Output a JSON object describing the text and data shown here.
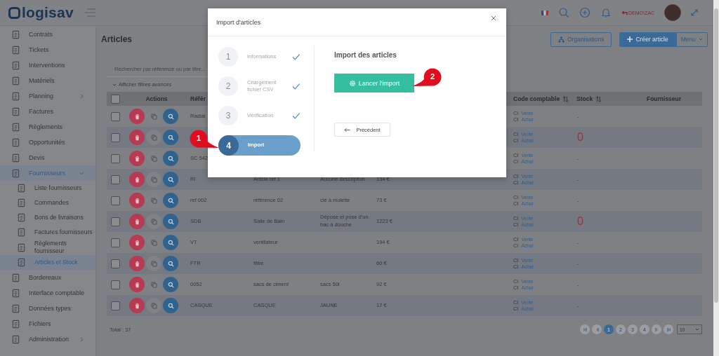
{
  "sidebar": {
    "logo": "logisav",
    "items": [
      {
        "label": "Contrats",
        "selected": false
      },
      {
        "label": "Tickets",
        "selected": false
      },
      {
        "label": "Interventions",
        "selected": false
      },
      {
        "label": "Matériels",
        "selected": false
      },
      {
        "label": "Planning",
        "selected": false,
        "expanded": false
      },
      {
        "label": "Factures",
        "selected": false
      },
      {
        "label": "Règlements",
        "selected": false
      },
      {
        "label": "Opportunités",
        "selected": false
      },
      {
        "label": "Devis",
        "selected": false
      },
      {
        "label": "Fournisseurs",
        "selected": true,
        "expanded": true,
        "children": [
          {
            "label": "Liste fournisseurs",
            "selected": false
          },
          {
            "label": "Commandes",
            "selected": false
          },
          {
            "label": "Bons de livraisons",
            "selected": false
          },
          {
            "label": "Factures fournisseurs",
            "selected": false
          },
          {
            "label": "Règlements fournisseur",
            "selected": false
          },
          {
            "label": "Articles et Stock",
            "selected": true
          }
        ]
      },
      {
        "label": "Bordereaux",
        "selected": false
      },
      {
        "label": "Interface comptable",
        "selected": false
      },
      {
        "label": "Données types",
        "selected": false
      },
      {
        "label": "Fichiers",
        "selected": false
      },
      {
        "label": "Administration",
        "selected": false,
        "expanded": false
      }
    ]
  },
  "topbar": {
    "user": "DEMO\\ZAC"
  },
  "page": {
    "title": "Articles",
    "buttons": [
      {
        "label": "Organisations",
        "kind": "outline"
      },
      {
        "label": "Créer article",
        "kind": "primary"
      },
      {
        "label": "Menu",
        "kind": "dropdown"
      }
    ]
  },
  "search": {
    "placeholder": "Rechercher par référence ou par titre..."
  },
  "filters_toggle": "Afficher filtres avancés",
  "table": {
    "select_all": {
      "checked": false
    },
    "columns": [
      {
        "label": "Actions",
        "sortable": false
      },
      {
        "label": "Référ",
        "sortable": false
      },
      {
        "label": "Code comptable",
        "sortable": true
      },
      {
        "label": "Stock",
        "sortable": true
      },
      {
        "label": "Fournisseur",
        "sortable": false
      }
    ],
    "rows": [
      {
        "checked": false,
        "reference": "Radiat",
        "codes": [
          {
            "code": "CI",
            "link": "Vente"
          },
          {
            "code": "CI",
            "link": "Achat"
          }
        ],
        "stock": {
          "text": "-",
          "low": false
        }
      },
      {
        "checked": false,
        "codes": [
          {
            "code": "CI",
            "link": "Vente"
          },
          {
            "code": "CI",
            "link": "Achat"
          }
        ],
        "stock": {
          "text": "0",
          "low": true
        }
      },
      {
        "checked": false,
        "reference": "SC 542",
        "codes": [
          {
            "code": "CI",
            "link": "Vente"
          },
          {
            "code": "CI",
            "link": "Achat"
          }
        ],
        "stock": {
          "text": "-",
          "low": false
        }
      },
      {
        "checked": false,
        "reference": "RI",
        "title": "Article ref 1",
        "description": "Aucune descripiton",
        "price": "134 €",
        "codes": [
          {
            "code": "CI",
            "link": "Vente"
          },
          {
            "code": "CI",
            "link": "Achat"
          }
        ],
        "stock": {
          "text": "-",
          "low": false
        }
      },
      {
        "checked": false,
        "reference": "ref 002",
        "title": "référence 02",
        "description": "clé à molette",
        "price": "73 €",
        "codes": [
          {
            "code": "CI",
            "link": "Vente"
          },
          {
            "code": "CI",
            "link": "Achat"
          }
        ],
        "stock": {
          "text": "-",
          "low": false
        }
      },
      {
        "checked": false,
        "reference": "SDB",
        "title": "Salle de Bain",
        "description": "Dépose et pose d'un bac à douche",
        "price": "1223 €",
        "codes": [
          {
            "code": "CI",
            "link": "Vente"
          },
          {
            "code": "CI",
            "link": "Achat"
          }
        ],
        "stock": {
          "text": "0",
          "low": true
        }
      },
      {
        "checked": false,
        "reference": "VT",
        "title": "ventilateur",
        "price": "194 €",
        "codes": [
          {
            "code": "CI",
            "link": "Vente"
          },
          {
            "code": "CI",
            "link": "Achat"
          }
        ],
        "stock": {
          "text": "-",
          "low": false
        }
      },
      {
        "checked": false,
        "reference": "FTR",
        "title": "filtre",
        "price": "60 €",
        "codes": [
          {
            "code": "CI",
            "link": "Vente"
          },
          {
            "code": "CI",
            "link": "Achat"
          }
        ],
        "stock": {
          "text": "-",
          "low": false
        }
      },
      {
        "checked": false,
        "reference": "0052",
        "title": "sacs de ciment",
        "description": "sacs 50l",
        "price": "92 €",
        "codes": [
          {
            "code": "CI",
            "link": "Vente"
          },
          {
            "code": "CI",
            "link": "Achat"
          }
        ],
        "stock": {
          "text": "-",
          "low": false
        }
      },
      {
        "checked": false,
        "reference": "CASQUE",
        "title": "CASQUE",
        "description": "JAUNE",
        "price": "17 €",
        "codes": [
          {
            "code": "CI",
            "link": "Vente"
          },
          {
            "code": "CI",
            "link": "Achat"
          }
        ],
        "stock": {
          "text": "-",
          "low": false
        }
      }
    ]
  },
  "total": "Total : 37",
  "pagination": {
    "pages": [
      {
        "label": "1",
        "selected": true
      },
      {
        "label": "2",
        "selected": false
      },
      {
        "label": "3",
        "selected": false
      },
      {
        "label": "4",
        "selected": false
      }
    ],
    "page_size": "10"
  },
  "modal": {
    "title": "Import d'articles",
    "heading": "Import des articles",
    "steps": [
      {
        "number": "1",
        "label": "Informations",
        "done": true,
        "selected": false
      },
      {
        "number": "2",
        "label": "Chargement fichier CSV",
        "done": true,
        "selected": false
      },
      {
        "number": "3",
        "label": "Vérification",
        "done": true,
        "selected": false
      },
      {
        "number": "4",
        "label": "Import",
        "done": false,
        "selected": true
      }
    ],
    "primary_button": "Lancer l'import",
    "back_button": "Précédent"
  },
  "callouts": [
    {
      "number": "1"
    },
    {
      "number": "2"
    }
  ]
}
